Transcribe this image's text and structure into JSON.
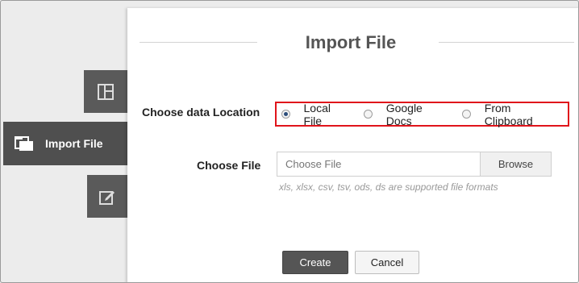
{
  "sidebar": {
    "import_label": "Import File"
  },
  "dialog": {
    "title": "Import File",
    "location_label": "Choose data Location",
    "location_options": [
      {
        "label": "Local File",
        "selected": true
      },
      {
        "label": "Google Docs",
        "selected": false
      },
      {
        "label": "From Clipboard",
        "selected": false
      }
    ],
    "file_label": "Choose File",
    "file_placeholder": "Choose File",
    "browse_label": "Browse",
    "hint": "xls, xlsx, csv, tsv, ods, ds are supported file formats",
    "create_label": "Create",
    "cancel_label": "Cancel"
  },
  "colors": {
    "highlight": "#e0141b",
    "rail": "#5a5a5a"
  }
}
